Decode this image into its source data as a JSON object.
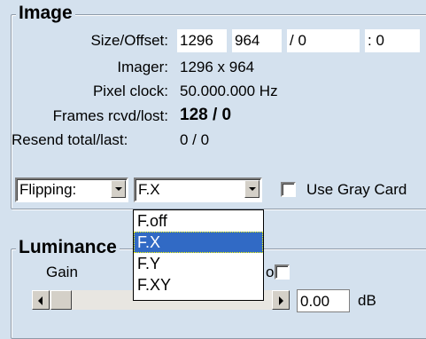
{
  "image_group": {
    "title": "Image",
    "size_offset_label": "Size/Offset:",
    "size_w": "1296",
    "size_h": "964",
    "offset_sep1": "/ 0",
    "offset_sep2": ": 0",
    "imager_label": "Imager:",
    "imager_value": "1296 x  964",
    "pixel_clock_label": "Pixel clock:",
    "pixel_clock_value": "50.000.000 Hz",
    "frames_label": "Frames rcvd/lost:",
    "frames_value": "128 / 0",
    "resend_label": "Resend total/last:",
    "resend_value": "0 / 0",
    "flipping_label": "Flipping:",
    "flip_selected": "F.X",
    "use_gray_card_label": "Use Gray Card"
  },
  "flip_options": [
    "F.off",
    "F.X",
    "F.Y",
    "F.XY"
  ],
  "flip_selected_index": 1,
  "luminance_group": {
    "title": "Luminance",
    "gain_label": "Gain",
    "auto_label": "o",
    "gain_value": "0.00",
    "gain_unit": "dB"
  }
}
